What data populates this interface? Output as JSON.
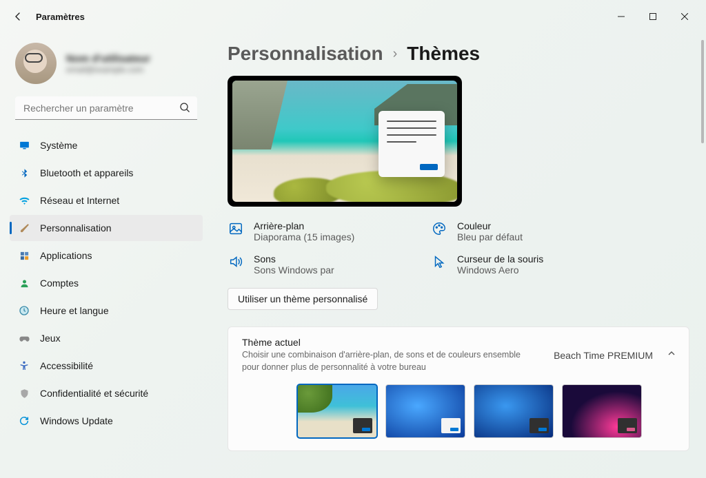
{
  "window": {
    "title": "Paramètres"
  },
  "account": {
    "name": "Nom d'utilisateur",
    "email": "email@example.com"
  },
  "search": {
    "placeholder": "Rechercher un paramètre"
  },
  "sidebar": {
    "items": [
      {
        "label": "Système",
        "icon": "monitor",
        "color": "#0078d4"
      },
      {
        "label": "Bluetooth et appareils",
        "icon": "bluetooth",
        "color": "#0067c0"
      },
      {
        "label": "Réseau et Internet",
        "icon": "wifi",
        "color": "#00a0e0"
      },
      {
        "label": "Personnalisation",
        "icon": "brush",
        "color": "#8a6a4a",
        "active": true
      },
      {
        "label": "Applications",
        "icon": "apps",
        "color": "#4a7ab0"
      },
      {
        "label": "Comptes",
        "icon": "person",
        "color": "#2aa058"
      },
      {
        "label": "Heure et langue",
        "icon": "clock",
        "color": "#3a8aa8"
      },
      {
        "label": "Jeux",
        "icon": "gamepad",
        "color": "#888"
      },
      {
        "label": "Accessibilité",
        "icon": "accessibility",
        "color": "#3a6ac0"
      },
      {
        "label": "Confidentialité et sécurité",
        "icon": "shield",
        "color": "#888"
      },
      {
        "label": "Windows Update",
        "icon": "update",
        "color": "#0090d8"
      }
    ]
  },
  "breadcrumb": {
    "parent": "Personnalisation",
    "current": "Thèmes"
  },
  "settings": {
    "background": {
      "label": "Arrière-plan",
      "value": "Diaporama (15 images)"
    },
    "color": {
      "label": "Couleur",
      "value": "Bleu par défaut"
    },
    "sounds": {
      "label": "Sons",
      "value": "Sons Windows par"
    },
    "cursor": {
      "label": "Curseur de la souris",
      "value": "Windows Aero"
    }
  },
  "use_custom_label": "Utiliser un thème personnalisé",
  "current_theme": {
    "title": "Thème actuel",
    "description": "Choisir une combinaison d'arrière-plan, de sons et de couleurs ensemble pour donner plus de personnalité à votre bureau",
    "name": "Beach Time PREMIUM"
  }
}
